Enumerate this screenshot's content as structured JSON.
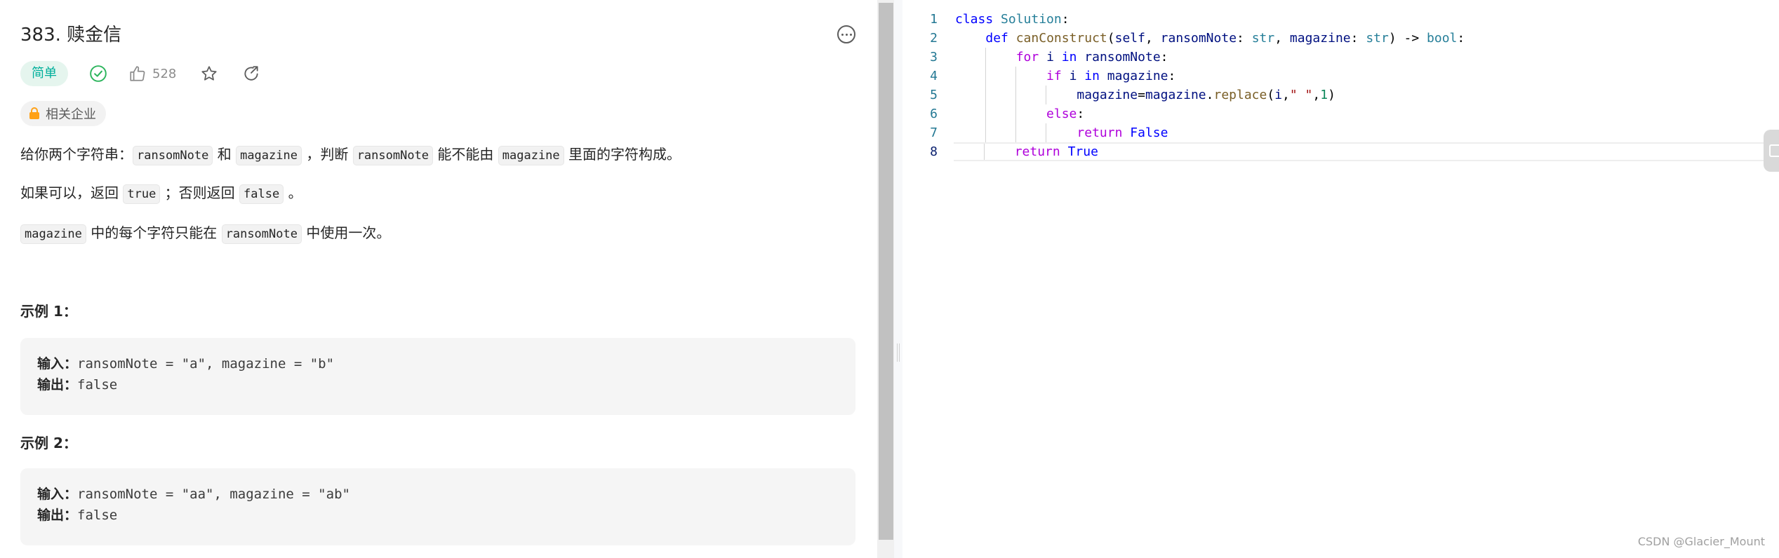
{
  "problem": {
    "title": "383. 赎金信",
    "difficulty": "简单",
    "likes": "528",
    "company_tag": "相关企业"
  },
  "description": {
    "line1": {
      "t1": "给你两个字符串：",
      "c1": "ransomNote",
      "t2": " 和 ",
      "c2": "magazine",
      "t3": " ，判断 ",
      "c3": "ransomNote",
      "t4": " 能不能由 ",
      "c4": "magazine",
      "t5": " 里面的字符构成。"
    },
    "line2": {
      "t1": "如果可以，返回 ",
      "c1": "true",
      "t2": " ；否则返回 ",
      "c2": "false",
      "t3": " 。"
    },
    "line3": {
      "c1": "magazine",
      "t1": " 中的每个字符只能在 ",
      "c2": "ransomNote",
      "t2": " 中使用一次。"
    }
  },
  "examples": [
    {
      "heading": "示例 1：",
      "input_label": "输入：",
      "input_value": "ransomNote = \"a\", magazine = \"b\"",
      "output_label": "输出：",
      "output_value": "false"
    },
    {
      "heading": "示例 2：",
      "input_label": "输入：",
      "input_value": "ransomNote = \"aa\", magazine = \"ab\"",
      "output_label": "输出：",
      "output_value": "false"
    }
  ],
  "editor": {
    "line_numbers": [
      "1",
      "2",
      "3",
      "4",
      "5",
      "6",
      "7",
      "8"
    ],
    "current_line": "8"
  },
  "watermark": "CSDN @Glacier_Mount",
  "icons": [
    "more-icon",
    "solved-check-icon",
    "thumbs-up-icon",
    "star-icon",
    "share-icon",
    "lock-icon"
  ],
  "colors": {
    "difficulty_green": "#00af9b",
    "difficulty_bg": "#e5f5ee",
    "keyword_blue": "#0000ff",
    "keyword_purple": "#af00db",
    "line_number": "#237893"
  }
}
